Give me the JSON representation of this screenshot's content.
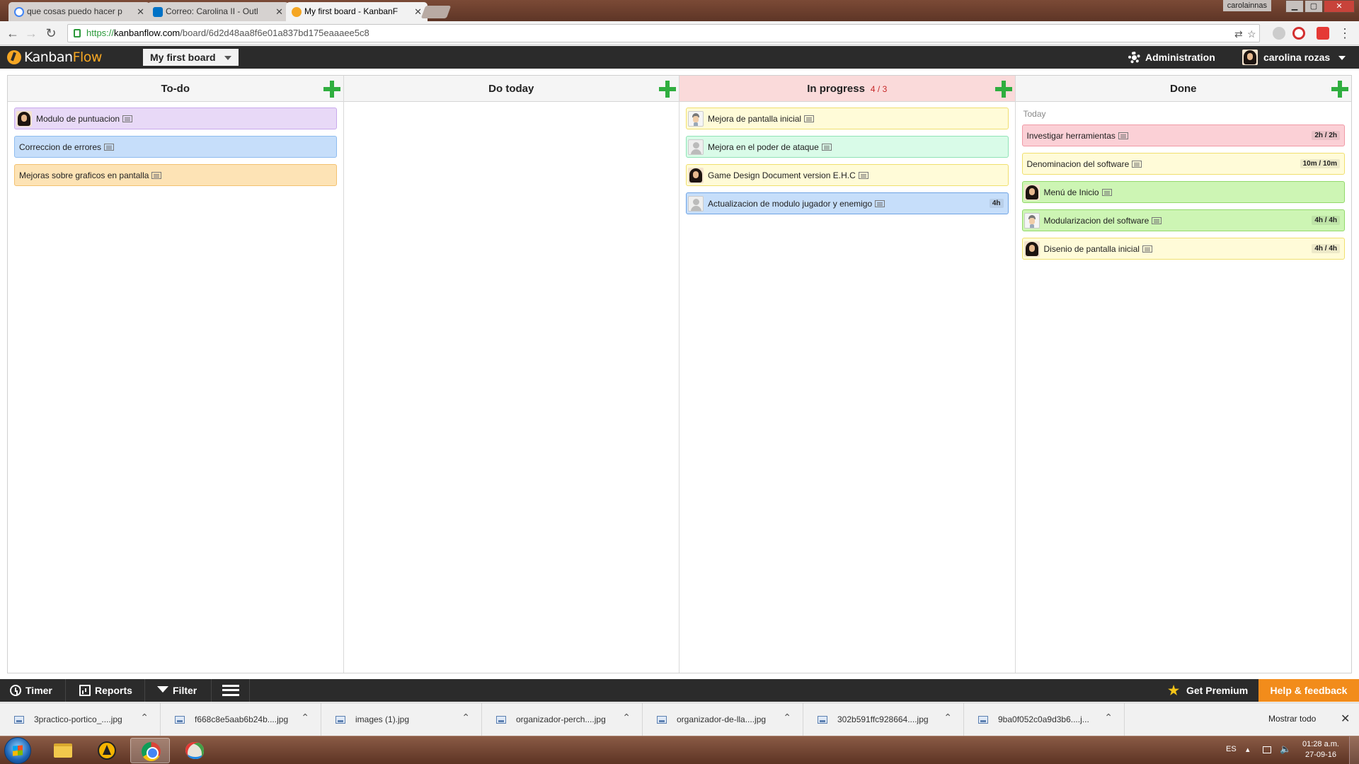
{
  "browser": {
    "tabs": [
      {
        "title": "que cosas puedo hacer p",
        "favicon": "google-icon"
      },
      {
        "title": "Correo: Carolina II - Outl",
        "favicon": "outlook-icon"
      },
      {
        "title": "My first board - KanbanF",
        "favicon": "kanbanflow-icon",
        "active": true
      }
    ],
    "profile_name": "carolainnas",
    "url_scheme": "https://",
    "url_host": "kanbanflow.com",
    "url_path": "/board/6d2d48aa8f6e01a837bd175eaaaee5c8"
  },
  "header": {
    "logo_kanban": "Kanban",
    "logo_flow": "Flow",
    "board_name": "My first board",
    "administration_label": "Administration",
    "user_name": "carolina rozas"
  },
  "columns": [
    {
      "name": "To-do",
      "tasks": [
        {
          "title": "Modulo de puntuacion",
          "color": "#e8d9f7",
          "border": "#c9a9ec",
          "avatar": "female"
        },
        {
          "title": "Correccion de errores",
          "color": "#c6defa",
          "border": "#8fbcef",
          "avatar": ""
        },
        {
          "title": "Mejoras sobre graficos en pantalla",
          "color": "#fde3b5",
          "border": "#f3c170",
          "avatar": ""
        }
      ]
    },
    {
      "name": "Do today",
      "tasks": []
    },
    {
      "name": "In progress",
      "wip": "4 / 3",
      "over_limit": true,
      "tasks": [
        {
          "title": "Mejora de pantalla inicial",
          "color": "#fffbd8",
          "border": "#f0df6e",
          "avatar": "male"
        },
        {
          "title": "Mejora en el poder de ataque",
          "color": "#d9fbe8",
          "border": "#90e3b7",
          "avatar": "generic"
        },
        {
          "title": "Game Design Document version E.H.C",
          "color": "#fffbd8",
          "border": "#f0df6e",
          "avatar": "female"
        },
        {
          "title": "Actualizacion de modulo jugador y enemigo",
          "color": "#c6defa",
          "border": "#6ea3e4",
          "avatar": "generic",
          "time": "4h"
        }
      ]
    },
    {
      "name": "Done",
      "swimlane_label": "Today",
      "tasks": [
        {
          "title": "Investigar herramientas",
          "color": "#fbd0d6",
          "border": "#f09aa6",
          "avatar": "",
          "time": "2h / 2h"
        },
        {
          "title": "Denominacion del software",
          "color": "#fffbd8",
          "border": "#f0df6e",
          "avatar": "",
          "time": "10m / 10m"
        },
        {
          "title": "Menú de Inicio",
          "color": "#cdf5b4",
          "border": "#93d96a",
          "avatar": "female"
        },
        {
          "title": "Modularizacion del software",
          "color": "#cdf5b4",
          "border": "#93d96a",
          "avatar": "male",
          "time": "4h / 4h"
        },
        {
          "title": "Disenio de pantalla inicial",
          "color": "#fffbd8",
          "border": "#f0df6e",
          "avatar": "female",
          "time": "4h / 4h"
        }
      ]
    }
  ],
  "footer": {
    "timer_label": "Timer",
    "reports_label": "Reports",
    "filter_label": "Filter",
    "premium_label": "Get Premium",
    "help_label": "Help & feedback"
  },
  "downloads": {
    "files": [
      "3practico-portico_....jpg",
      "f668c8e5aab6b24b....jpg",
      "images (1).jpg",
      "organizador-perch....jpg",
      "organizador-de-lla....jpg",
      "302b591ffc928664....jpg",
      "9ba0f052c0a9d3b6....j..."
    ],
    "show_all_label": "Mostrar todo"
  },
  "taskbar": {
    "language": "ES",
    "time": "01:28 a.m.",
    "date": "27-09-16"
  }
}
